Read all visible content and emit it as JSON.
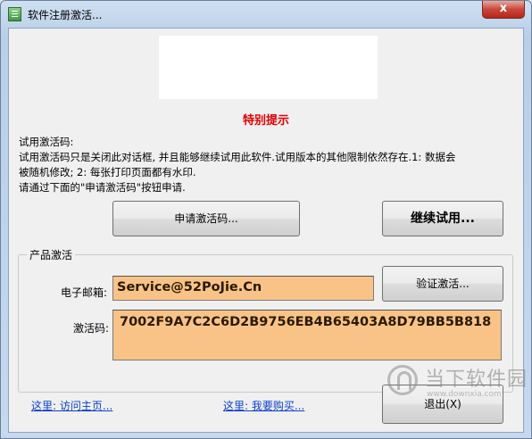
{
  "window": {
    "title": "软件注册激活...",
    "close_label": "x"
  },
  "notice": {
    "title": "特别提示",
    "lines": [
      "试用激活码:",
      "    试用激活码只是关闭此对话框, 并且能够继续试用此软件.试用版本的其他限制依然存在.1: 数据会",
      "被随机修改; 2: 每张打印页面都有水印.",
      "    请通过下面的\"申请激活码\"按钮申请."
    ]
  },
  "buttons": {
    "apply": "申请激活码...",
    "continue_trial": "继续试用...",
    "verify": "验证激活...",
    "exit": "退出(X)"
  },
  "activation": {
    "group_title": "产品激活",
    "email_label": "电子邮箱:",
    "email_value": "Service@52PoJie.Cn",
    "code_label": "激活码:",
    "code_value": "7002F9A7C2C6D2B9756EB4B65403A8D79BB5B818"
  },
  "links": {
    "homepage": "这里: 访问主页...",
    "buy": "这里: 我要购买..."
  },
  "watermark": {
    "text": "当下软件园",
    "sub": "www.downxia.com"
  }
}
